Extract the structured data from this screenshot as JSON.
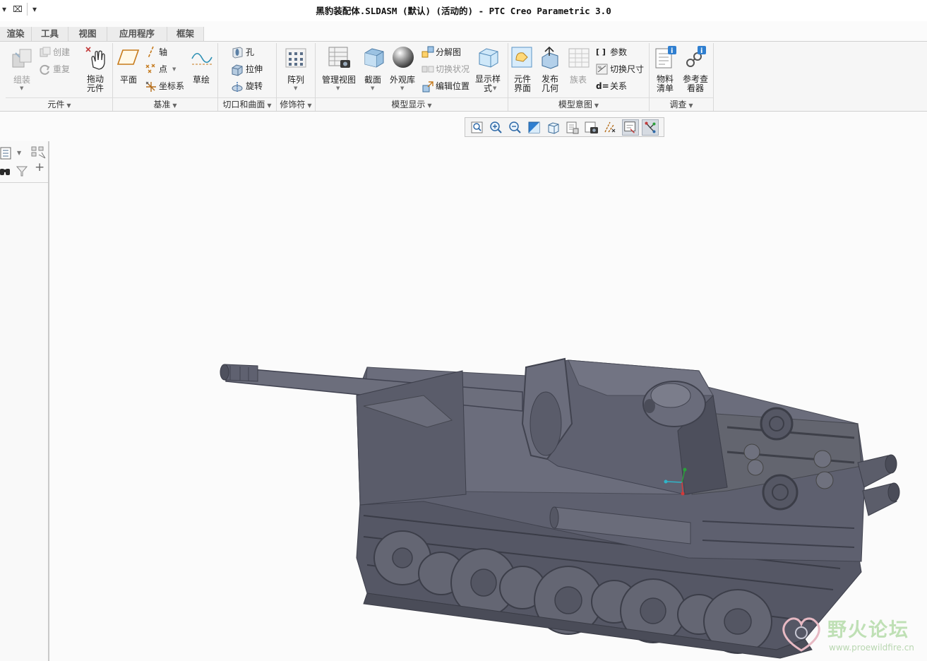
{
  "window": {
    "title": "黑豹装配体.SLDASM (默认) (活动的) - PTC Creo Parametric 3.0"
  },
  "quick_access": {
    "dropdown_glyph": "▾",
    "close_glyph": "⌧",
    "customize_glyph": "▾"
  },
  "tabs": [
    {
      "label": "渲染"
    },
    {
      "label": "工具"
    },
    {
      "label": "视图"
    },
    {
      "label": "应用程序"
    },
    {
      "label": "框架"
    }
  ],
  "ribbon": {
    "components": {
      "group_label": "元件",
      "assemble": "组装",
      "create": "创建",
      "repeat": "重复",
      "drag_components": "拖动\n元件"
    },
    "datum": {
      "group_label": "基准",
      "plane": "平面",
      "axis": "轴",
      "point": "点",
      "coordinate_system": "坐标系",
      "sketch": "草绘"
    },
    "cut_surface": {
      "group_label": "切口和曲面",
      "hole": "孔",
      "extrude": "拉伸",
      "revolve": "旋转"
    },
    "modifiers": {
      "group_label": "修饰符",
      "pattern": "阵列"
    },
    "model_display": {
      "group_label": "模型显示",
      "manage_views": "管理视图",
      "section": "截面",
      "appearance_gallery": "外观库",
      "exploded_view": "分解图",
      "toggle_status": "切换状况",
      "edit_position": "编辑位置",
      "display_style": "显示样\n式"
    },
    "model_intent": {
      "group_label": "模型意图",
      "component_interface": "元件\n界面",
      "publish_geometry": "发布\n几何",
      "family_table": "族表",
      "parameters": "参数",
      "switch_dimensions": "切换尺寸",
      "relations": "关系",
      "parameters_glyph": "[ ]",
      "relations_glyph": "d="
    },
    "investigate": {
      "group_label": "调查",
      "bom": "物料\n清单",
      "reference_viewer": "参考查\n看器"
    }
  },
  "watermark": {
    "title": "野火论坛",
    "url": "www.proewildfire.cn"
  },
  "colors": {
    "model_fill": "#5e606f",
    "model_dark": "#444654",
    "model_light": "#7a7c8b",
    "accent_blue": "#2f7fd0",
    "watermark_green": "#bfe0b5"
  }
}
